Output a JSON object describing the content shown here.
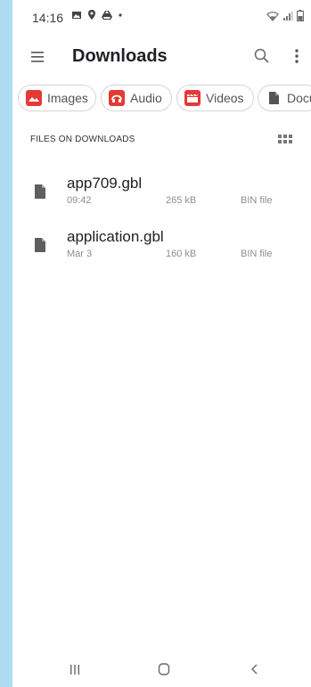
{
  "status_bar": {
    "time": "14:16",
    "icons": [
      "gallery-icon",
      "location-icon",
      "drive-icon",
      "dot-icon"
    ],
    "right_icons": [
      "wifi-icon",
      "signal-icon",
      "battery-icon"
    ]
  },
  "app_bar": {
    "title": "Downloads",
    "menu_icon": "hamburger-menu-icon",
    "search_icon": "search-icon",
    "more_icon": "more-vertical-icon"
  },
  "chips": [
    {
      "label": "Images",
      "icon": "image-icon",
      "color": "#e53935"
    },
    {
      "label": "Audio",
      "icon": "headphones-icon",
      "color": "#e53935"
    },
    {
      "label": "Videos",
      "icon": "clapperboard-icon",
      "color": "#e53935"
    },
    {
      "label": "Docu",
      "icon": "document-icon",
      "color": "#555555"
    }
  ],
  "section": {
    "label": "FILES ON DOWNLOADS",
    "view_toggle_icon": "grid-view-icon"
  },
  "files": [
    {
      "name": "app709.gbl",
      "date": "09:42",
      "size": "265 kB",
      "type": "BIN file"
    },
    {
      "name": "application.gbl",
      "date": "Mar 3",
      "size": "160 kB",
      "type": "BIN file"
    }
  ],
  "nav_bar": {
    "recent_icon": "recent-apps-icon",
    "home_icon": "home-icon",
    "back_icon": "back-icon"
  }
}
